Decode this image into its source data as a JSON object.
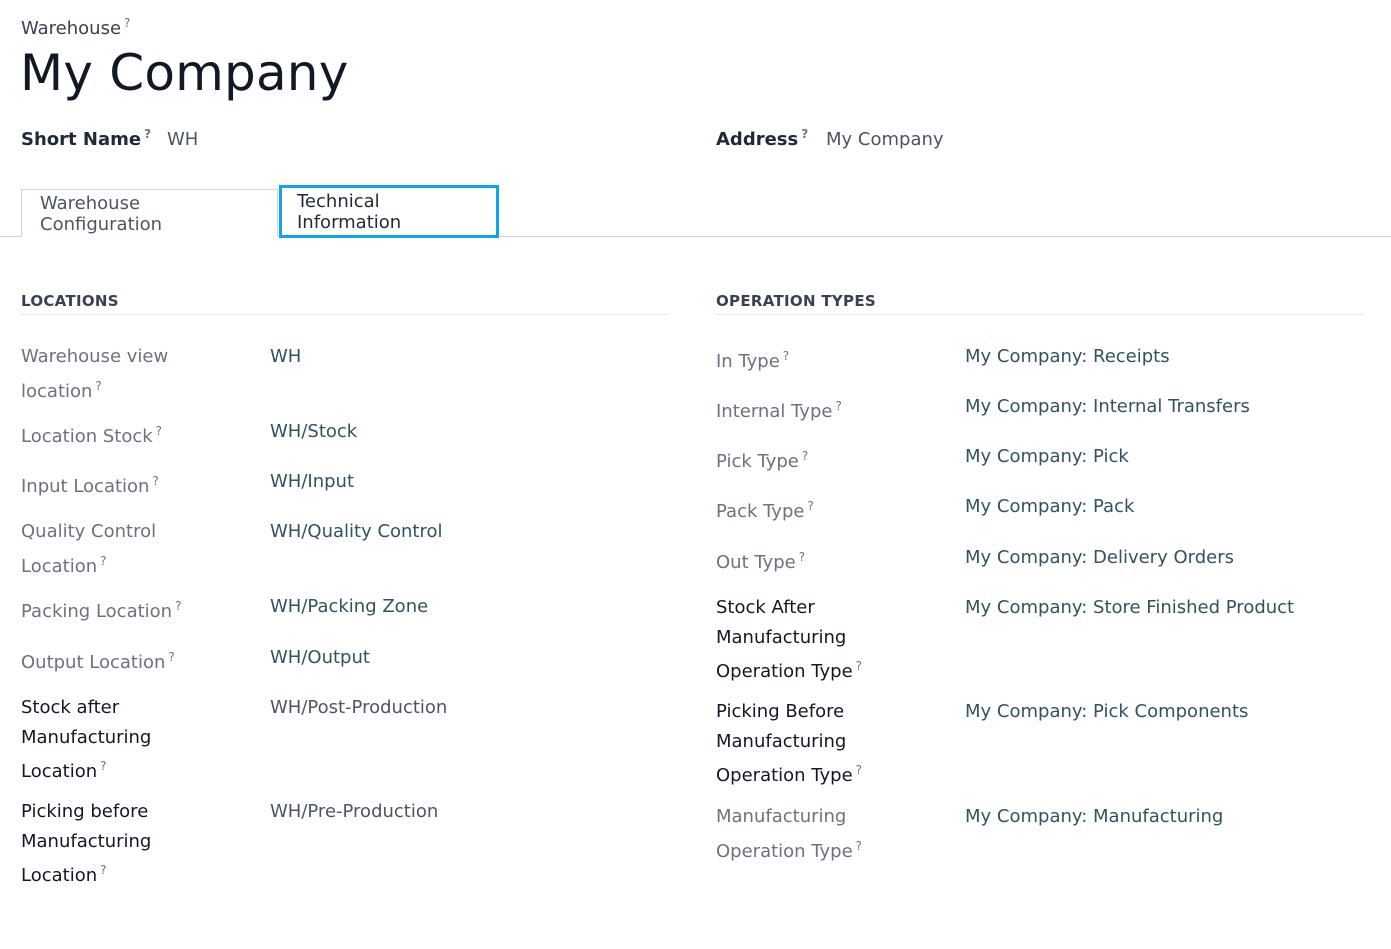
{
  "header": {
    "model_label": "Warehouse",
    "record_name": "My Company"
  },
  "fields": {
    "short_name_label": "Short Name",
    "short_name_value": "WH",
    "address_label": "Address",
    "address_value": "My Company"
  },
  "tabs": [
    {
      "label": "Warehouse Configuration",
      "active": false
    },
    {
      "label": "Technical Information",
      "active": true
    }
  ],
  "locations": {
    "title": "LOCATIONS",
    "rows": [
      {
        "label_lines": [
          "Warehouse view",
          "location"
        ],
        "value": "WH"
      },
      {
        "label_lines": [
          "Location Stock"
        ],
        "value": "WH/Stock"
      },
      {
        "label_lines": [
          "Input Location"
        ],
        "value": "WH/Input"
      },
      {
        "label_lines": [
          "Quality Control",
          "Location"
        ],
        "value": "WH/Quality Control"
      },
      {
        "label_lines": [
          "Packing Location"
        ],
        "value": "WH/Packing Zone"
      },
      {
        "label_lines": [
          "Output Location"
        ],
        "value": "WH/Output"
      },
      {
        "label_lines": [
          "Stock after",
          "Manufacturing",
          "Location"
        ],
        "value": "WH/Post-Production"
      },
      {
        "label_lines": [
          "Picking before",
          "Manufacturing",
          "Location"
        ],
        "value": "WH/Pre-Production"
      }
    ]
  },
  "operation_types": {
    "title": "OPERATION TYPES",
    "rows": [
      {
        "label_lines": [
          "In Type"
        ],
        "value": "My Company: Receipts"
      },
      {
        "label_lines": [
          "Internal Type"
        ],
        "value": "My Company: Internal Transfers"
      },
      {
        "label_lines": [
          "Pick Type"
        ],
        "value": "My Company: Pick"
      },
      {
        "label_lines": [
          "Pack Type"
        ],
        "value": "My Company: Pack"
      },
      {
        "label_lines": [
          "Out Type"
        ],
        "value": "My Company: Delivery Orders"
      },
      {
        "label_lines": [
          "Stock After",
          "Manufacturing",
          "Operation Type"
        ],
        "value": "My Company: Store Finished Product"
      },
      {
        "label_lines": [
          "Picking Before",
          "Manufacturing",
          "Operation Type"
        ],
        "value": "My Company: Pick Components"
      },
      {
        "label_lines": [
          "Manufacturing",
          "Operation Type"
        ],
        "value": "My Company: Manufacturing"
      }
    ]
  },
  "help_marker": "?",
  "colors": {
    "active_tab_border": "#0ea5e9",
    "link_value": "#30545d"
  }
}
